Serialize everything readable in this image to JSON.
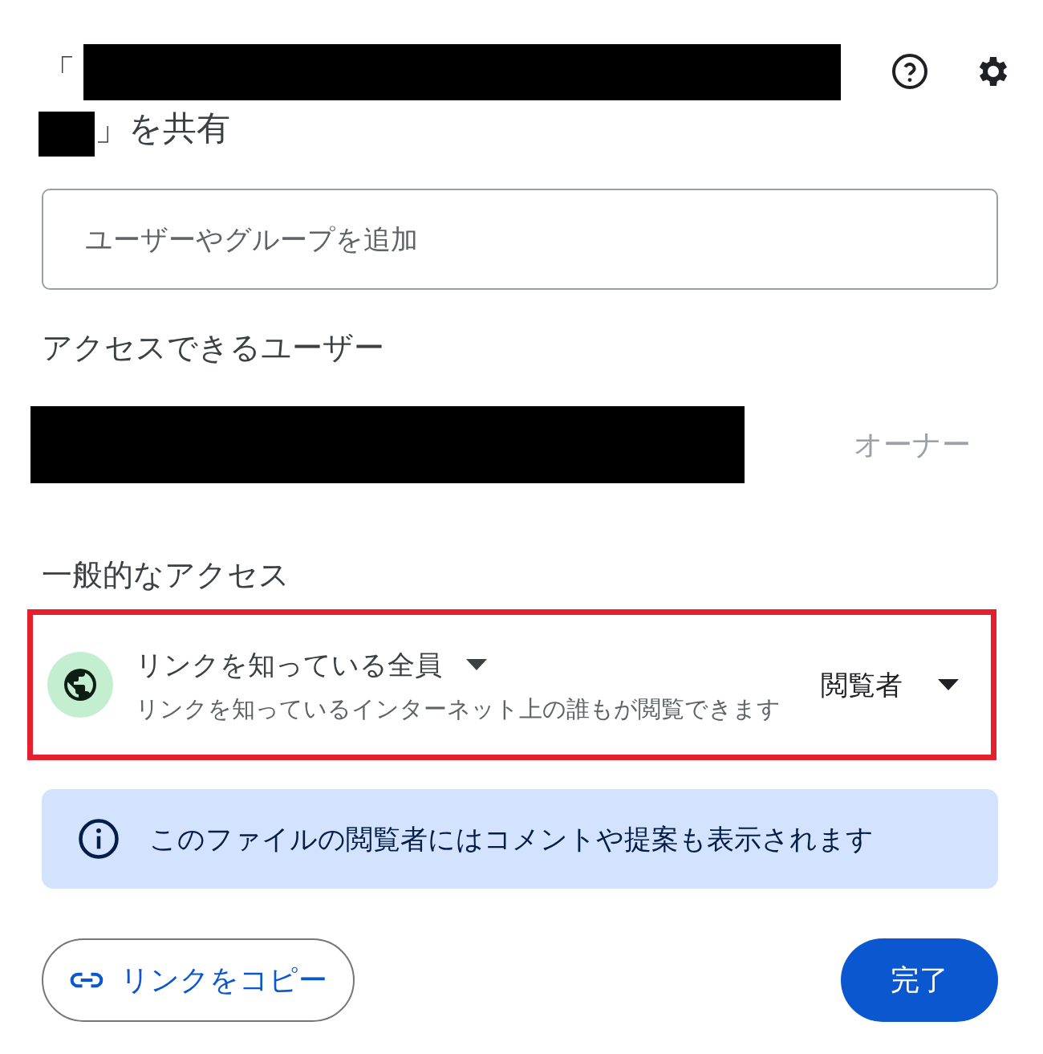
{
  "dialog": {
    "title_open": "「",
    "title_close": "」を共有"
  },
  "add_field": {
    "placeholder": "ユーザーやグループを追加"
  },
  "people_section": {
    "heading": "アクセスできるユーザー",
    "owner_role": "オーナー"
  },
  "general_access": {
    "heading": "一般的なアクセス",
    "scope": "リンクを知っている全員",
    "description": "リンクを知っているインターネット上の誰もが閲覧できます",
    "role": "閲覧者",
    "highlighted": true
  },
  "notice": {
    "text": "このファイルの閲覧者にはコメントや提案も表示されます"
  },
  "buttons": {
    "copy_link": "リンクをコピー",
    "done": "完了"
  }
}
